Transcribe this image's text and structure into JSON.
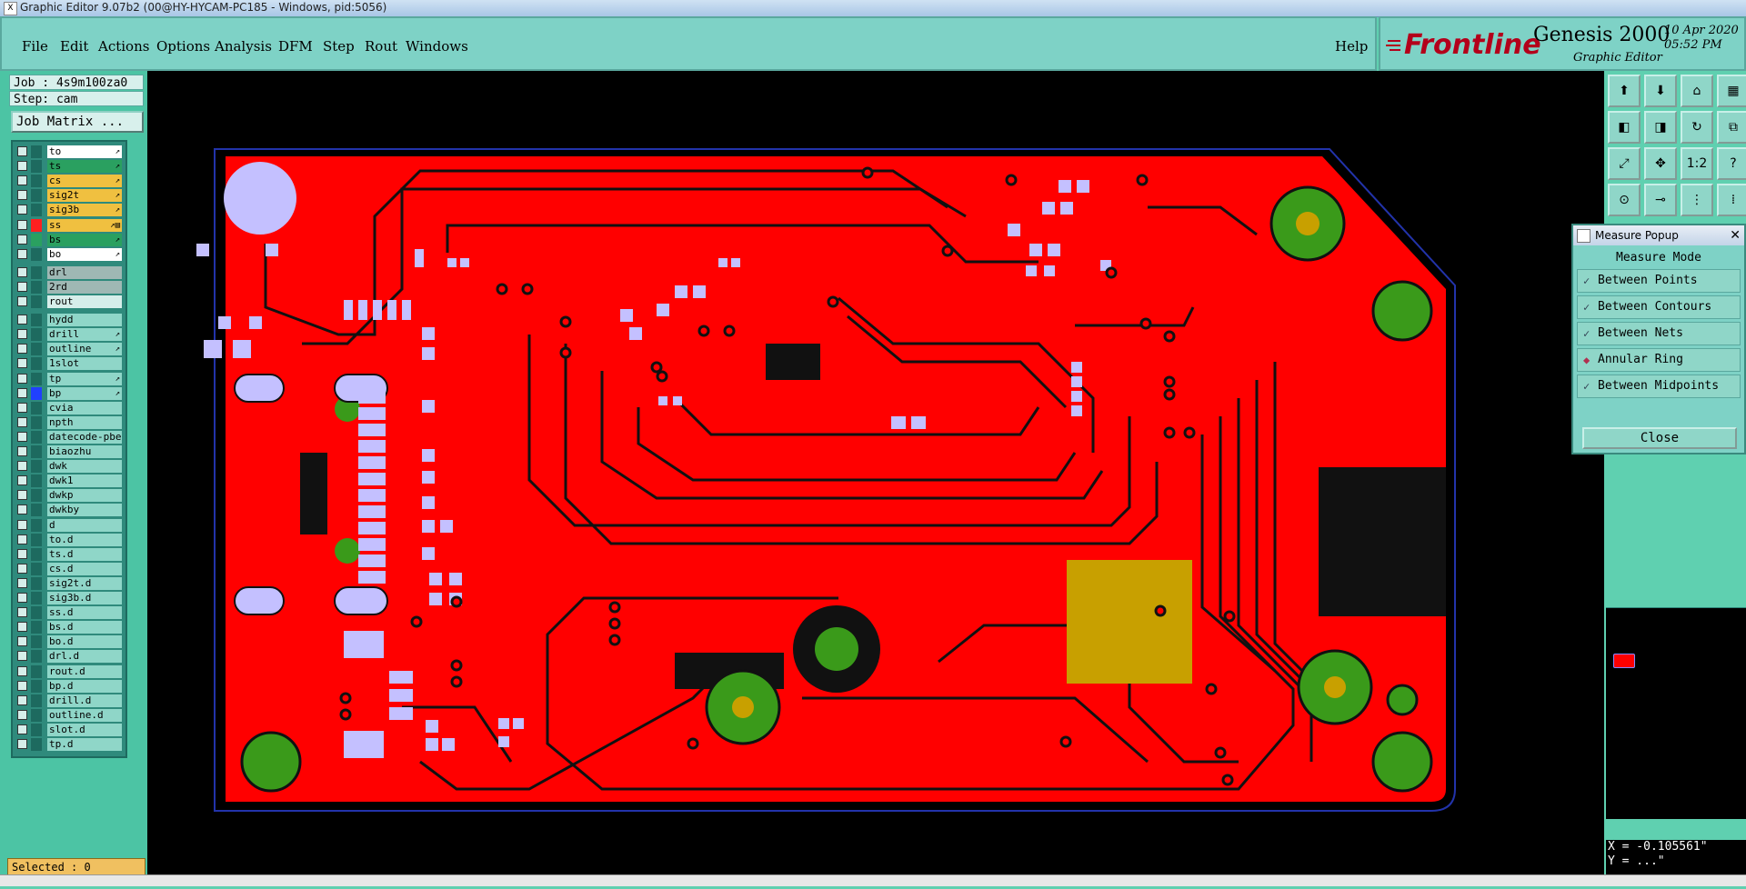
{
  "window": {
    "title": "Graphic Editor 9.07b2 (00@HY-HYCAM-PC185 - Windows, pid:5056)"
  },
  "menu": [
    {
      "label": "File"
    },
    {
      "label": "Edit"
    },
    {
      "label": "Actions"
    },
    {
      "label": "Options"
    },
    {
      "label": "Analysis"
    },
    {
      "label": "DFM"
    },
    {
      "label": "Step"
    },
    {
      "label": "Rout"
    },
    {
      "label": "Windows"
    }
  ],
  "help_label": "Help",
  "logo": {
    "brand": "Frontline",
    "product": "Genesis 2000",
    "subtitle": "Graphic Editor",
    "date": "10 Apr 2020",
    "time": "05:52 PM"
  },
  "job": {
    "job_label": "Job : 4s9m100za0",
    "step_label": "Step: cam",
    "matrix_button": "Job Matrix ..."
  },
  "layers": [
    {
      "name": "to",
      "color": "#ffffff",
      "flag": "↗"
    },
    {
      "name": "ts",
      "color": "#2aa060",
      "flag": "↗"
    },
    {
      "name": "cs",
      "color": "#f0c040",
      "flag": "↗"
    },
    {
      "name": "sig2t",
      "color": "#f0c040",
      "flag": "↗"
    },
    {
      "name": "sig3b",
      "color": "#f0c040",
      "flag": "↗"
    },
    {
      "name": "ss",
      "color": "#f0c040",
      "flag": "↗▤"
    },
    {
      "name": "bs",
      "color": "#2aa060",
      "flag": "↗"
    },
    {
      "name": "bo",
      "color": "#ffffff",
      "flag": "↗"
    },
    {
      "name": "drl",
      "color": "#9fb8b4",
      "flag": ""
    },
    {
      "name": "2rd",
      "color": "#9fb8b4",
      "flag": ""
    },
    {
      "name": "rout",
      "color": "#d6eeea",
      "flag": ""
    },
    {
      "name": "hydd",
      "color": "#8fd6c8",
      "flag": ""
    },
    {
      "name": "drill",
      "color": "#8fd6c8",
      "flag": "↗"
    },
    {
      "name": "outline",
      "color": "#8fd6c8",
      "flag": "↗"
    },
    {
      "name": "1slot",
      "color": "#8fd6c8",
      "flag": ""
    },
    {
      "name": "tp",
      "color": "#8fd6c8",
      "flag": "↗"
    },
    {
      "name": "bp",
      "color": "#8fd6c8",
      "flag": "↗"
    },
    {
      "name": "cvia",
      "color": "#8fd6c8",
      "flag": ""
    },
    {
      "name": "npth",
      "color": "#8fd6c8",
      "flag": ""
    },
    {
      "name": "datecode-pbe",
      "color": "#8fd6c8",
      "flag": ""
    },
    {
      "name": "biaozhu",
      "color": "#8fd6c8",
      "flag": ""
    },
    {
      "name": "dwk",
      "color": "#8fd6c8",
      "flag": ""
    },
    {
      "name": "dwk1",
      "color": "#8fd6c8",
      "flag": ""
    },
    {
      "name": "dwkp",
      "color": "#8fd6c8",
      "flag": ""
    },
    {
      "name": "dwkby",
      "color": "#8fd6c8",
      "flag": ""
    },
    {
      "name": "d",
      "color": "#8fd6c8",
      "flag": ""
    },
    {
      "name": "to.d",
      "color": "#8fd6c8",
      "flag": ""
    },
    {
      "name": "ts.d",
      "color": "#8fd6c8",
      "flag": ""
    },
    {
      "name": "cs.d",
      "color": "#8fd6c8",
      "flag": ""
    },
    {
      "name": "sig2t.d",
      "color": "#8fd6c8",
      "flag": ""
    },
    {
      "name": "sig3b.d",
      "color": "#8fd6c8",
      "flag": ""
    },
    {
      "name": "ss.d",
      "color": "#8fd6c8",
      "flag": ""
    },
    {
      "name": "bs.d",
      "color": "#8fd6c8",
      "flag": ""
    },
    {
      "name": "bo.d",
      "color": "#8fd6c8",
      "flag": ""
    },
    {
      "name": "drl.d",
      "color": "#8fd6c8",
      "flag": ""
    },
    {
      "name": "rout.d",
      "color": "#8fd6c8",
      "flag": ""
    },
    {
      "name": "bp.d",
      "color": "#8fd6c8",
      "flag": ""
    },
    {
      "name": "drill.d",
      "color": "#8fd6c8",
      "flag": ""
    },
    {
      "name": "outline.d",
      "color": "#8fd6c8",
      "flag": ""
    },
    {
      "name": "slot.d",
      "color": "#8fd6c8",
      "flag": ""
    },
    {
      "name": "tp.d",
      "color": "#8fd6c8",
      "flag": ""
    }
  ],
  "selected_label": "Selected : 0",
  "measure_popup": {
    "title": "Measure Popup",
    "mode_label": "Measure Mode",
    "options": [
      {
        "label": "Between Points",
        "selected": false
      },
      {
        "label": "Between Contours",
        "selected": false
      },
      {
        "label": "Between Nets",
        "selected": false
      },
      {
        "label": "Annular Ring",
        "selected": true
      },
      {
        "label": "Between Midpoints",
        "selected": false
      }
    ],
    "close_label": "Close"
  },
  "coords": {
    "x": "X = -0.105561\"",
    "y": "Y = ...\""
  },
  "toolbar_icons": [
    "zoom-in-icon",
    "zoom-out-icon",
    "home-icon",
    "window-icon",
    "pan-left-icon",
    "pan-right-icon",
    "redraw-icon",
    "split-icon",
    "fit-icon",
    "center-icon",
    "scale-icon",
    "help-icon",
    "snap-icon",
    "measure-icon",
    "net-icon",
    "layers-icon"
  ],
  "toolbar_labels": [
    "",
    "",
    "",
    "",
    "",
    "",
    "",
    "",
    "",
    "",
    "1:2",
    "?",
    "",
    "",
    "",
    ""
  ],
  "colors": {
    "board": "#ff0000",
    "copper_mark": "#1b1b1b",
    "pad": "#c4c0ff",
    "via_ring": "#3a9a1a",
    "accent": "#b3001b"
  }
}
